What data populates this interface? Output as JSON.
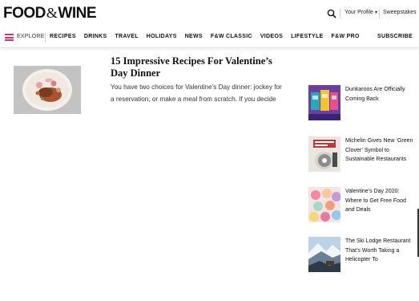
{
  "header": {
    "logo_left": "FOOD",
    "logo_amp": "&",
    "logo_right": "WINE",
    "profile_label": "Your Profile",
    "sweepstakes_label": "Sweepstakes"
  },
  "nav": {
    "explore_label": "EXPLORE",
    "items": [
      "RECIPES",
      "DRINKS",
      "TRAVEL",
      "HOLIDAYS",
      "NEWS",
      "F&W CLASSIC",
      "VIDEOS",
      "LIFESTYLE",
      "F&W PRO"
    ],
    "subscribe_label": "SUBSCRIBE"
  },
  "main_article": {
    "title": "15 Impressive Recipes For Valentine’s Day Dinner",
    "description": "You have two choices for Valentine’s Day dinner: jockey for a reservation, or make a meal from scratch. If you decide to cook, we’ve gathered a few elegant recipes to help fill out"
  },
  "sidebar": {
    "items": [
      {
        "title": "Dunkaroos Are Officially Coming Back"
      },
      {
        "title": "Michelin Gives New ‘Green Clover’ Symbol to Sustainable Restaurants"
      },
      {
        "title": "Valentine’s Day 2020: Where to Get Free Food and Deals"
      },
      {
        "title": "The Ski Lodge Restaurant That’s Worth Taking a Helicopter To"
      }
    ]
  },
  "colors": {
    "accent": "#d6336c",
    "text": "#111111"
  }
}
